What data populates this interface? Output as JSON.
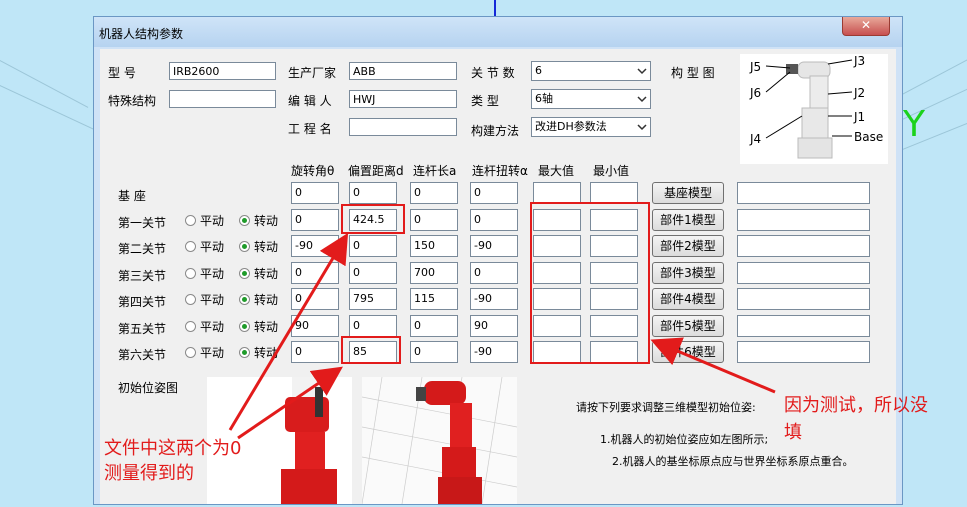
{
  "scene": {
    "y_axis_label": "Y"
  },
  "dialog": {
    "title": "机器人结构参数",
    "close_label": "✕"
  },
  "info": {
    "model_label": "型 号",
    "model_value": "IRB2600",
    "special_label": "特殊结构",
    "special_value": "",
    "manufacturer_label": "生产厂家",
    "manufacturer_value": "ABB",
    "editor_label": "编 辑 人",
    "editor_value": "HWJ",
    "project_label": "工 程 名",
    "project_value": "",
    "joints_label": "关 节 数",
    "joints_value": "6",
    "type_label": "类 型",
    "type_value": "6轴",
    "method_label": "构建方法",
    "method_value": "改进DH参数法",
    "config_label": "构 型 图"
  },
  "schematic_labels": {
    "j5": "J5",
    "j6": "J6",
    "j4": "J4",
    "j3": "J3",
    "j2": "J2",
    "j1": "J1",
    "base": "Base"
  },
  "table": {
    "headers": [
      "旋转角θ",
      "偏置距离d",
      "连杆长a",
      "连杆扭转α",
      "最大值",
      "最小值"
    ],
    "radio_labels": {
      "prismatic": "平动",
      "revolute": "转动"
    },
    "rows": [
      {
        "name": "基 座",
        "theta": "0",
        "d": "0",
        "a": "0",
        "alpha": "0",
        "max": "",
        "min": "",
        "button": "基座模型",
        "has_radio": false
      },
      {
        "name": "第一关节",
        "theta": "0",
        "d": "424.5",
        "a": "0",
        "alpha": "0",
        "max": "",
        "min": "",
        "button": "部件1模型",
        "has_radio": true
      },
      {
        "name": "第二关节",
        "theta": "-90",
        "d": "0",
        "a": "150",
        "alpha": "-90",
        "max": "",
        "min": "",
        "button": "部件2模型",
        "has_radio": true
      },
      {
        "name": "第三关节",
        "theta": "0",
        "d": "0",
        "a": "700",
        "alpha": "0",
        "max": "",
        "min": "",
        "button": "部件3模型",
        "has_radio": true
      },
      {
        "name": "第四关节",
        "theta": "0",
        "d": "795",
        "a": "115",
        "alpha": "-90",
        "max": "",
        "min": "",
        "button": "部件4模型",
        "has_radio": true
      },
      {
        "name": "第五关节",
        "theta": "90",
        "d": "0",
        "a": "0",
        "alpha": "90",
        "max": "",
        "min": "",
        "button": "部件5模型",
        "has_radio": true
      },
      {
        "name": "第六关节",
        "theta": "0",
        "d": "85",
        "a": "0",
        "alpha": "-90",
        "max": "",
        "min": "",
        "button": "部件6模型",
        "has_radio": true
      }
    ]
  },
  "initial_pose": {
    "label": "初始位姿图",
    "instruction": "请按下列要求调整三维模型初始位姿:",
    "note1": "1.机器人的初始位姿应如左图所示;",
    "note2": "2.机器人的基坐标原点应与世界坐标系原点重合。"
  },
  "annotations": {
    "left_line1": "文件中这两个为0",
    "left_line2": "测量得到的",
    "right_line1": "因为测试，所以没",
    "right_line2": "填"
  },
  "colors": {
    "annotation_red": "#e21b1b",
    "radio_green": "#1f9b2a",
    "robot_red": "#e02020",
    "y_axis_green": "#1bd21b"
  }
}
